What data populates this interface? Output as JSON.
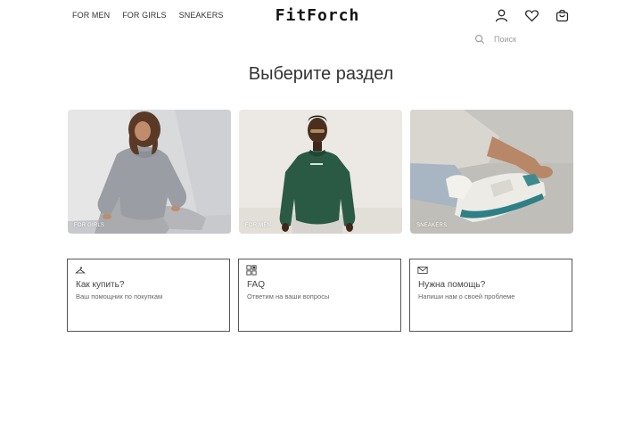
{
  "nav": {
    "men": "FOR MEN",
    "girls": "FOR GIRLS",
    "sneakers": "SNEAKERS"
  },
  "brand": {
    "logo": "FitForch"
  },
  "header_icons": [
    "user-icon",
    "heart-icon",
    "bag-icon"
  ],
  "search": {
    "placeholder": "Поиск",
    "icon": "search-icon"
  },
  "page_title": "Выберите раздел",
  "categories": [
    {
      "label": "FOR GIRLS"
    },
    {
      "label": "FOR MEN"
    },
    {
      "label": "SNEAKERS"
    }
  ],
  "help": [
    {
      "icon": "hanger-icon",
      "title": "Как купить?",
      "subtitle": "Ваш помощник по покупкам"
    },
    {
      "icon": "faq-icon",
      "title": "FAQ",
      "subtitle": "Ответим на ваши вопросы"
    },
    {
      "icon": "mail-icon",
      "title": "Нужна помощь?",
      "subtitle": "Напиши нам о своей проблеме"
    }
  ],
  "colors": {
    "text": "#222222",
    "border": "#555555",
    "sweatshirt_green": "#2a5a44"
  }
}
